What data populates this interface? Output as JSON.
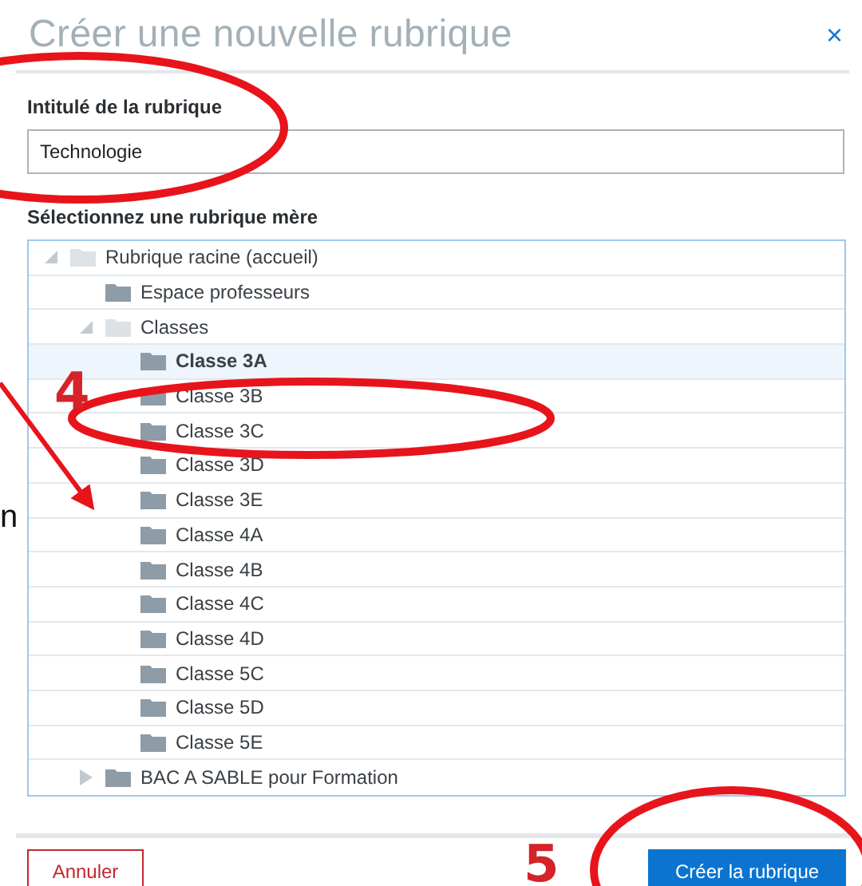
{
  "dialog": {
    "title": "Créer une nouvelle rubrique",
    "close": "×",
    "name_field": {
      "label": "Intitulé de la rubrique",
      "value": "Technologie"
    },
    "parent_tree": {
      "label": "Sélectionnez une rubrique mère",
      "nodes": [
        {
          "label": "Rubrique racine (accueil)",
          "expanded": true,
          "selected": false,
          "children": [
            {
              "label": "Espace professeurs",
              "selected": false
            },
            {
              "label": "Classes",
              "expanded": true,
              "selected": false,
              "children": [
                {
                  "label": "Classe 3A",
                  "selected": true
                },
                {
                  "label": "Classe 3B",
                  "selected": false
                },
                {
                  "label": "Classe 3C",
                  "selected": false
                },
                {
                  "label": "Classe 3D",
                  "selected": false
                },
                {
                  "label": "Classe 3E",
                  "selected": false
                },
                {
                  "label": "Classe 4A",
                  "selected": false
                },
                {
                  "label": "Classe 4B",
                  "selected": false
                },
                {
                  "label": "Classe 4C",
                  "selected": false
                },
                {
                  "label": "Classe 4D",
                  "selected": false
                },
                {
                  "label": "Classe 5C",
                  "selected": false
                },
                {
                  "label": "Classe 5D",
                  "selected": false
                },
                {
                  "label": "Classe 5E",
                  "selected": false
                }
              ]
            },
            {
              "label": "BAC A SABLE pour Formation",
              "expanded": false,
              "selected": false
            }
          ]
        }
      ]
    },
    "buttons": [
      {
        "label": "Annuler",
        "kind": "secondary"
      },
      {
        "label": "Créer la rubrique",
        "kind": "primary"
      }
    ]
  },
  "annotations": {
    "step_labels": [
      "4",
      "5"
    ],
    "edge_text": "n"
  }
}
